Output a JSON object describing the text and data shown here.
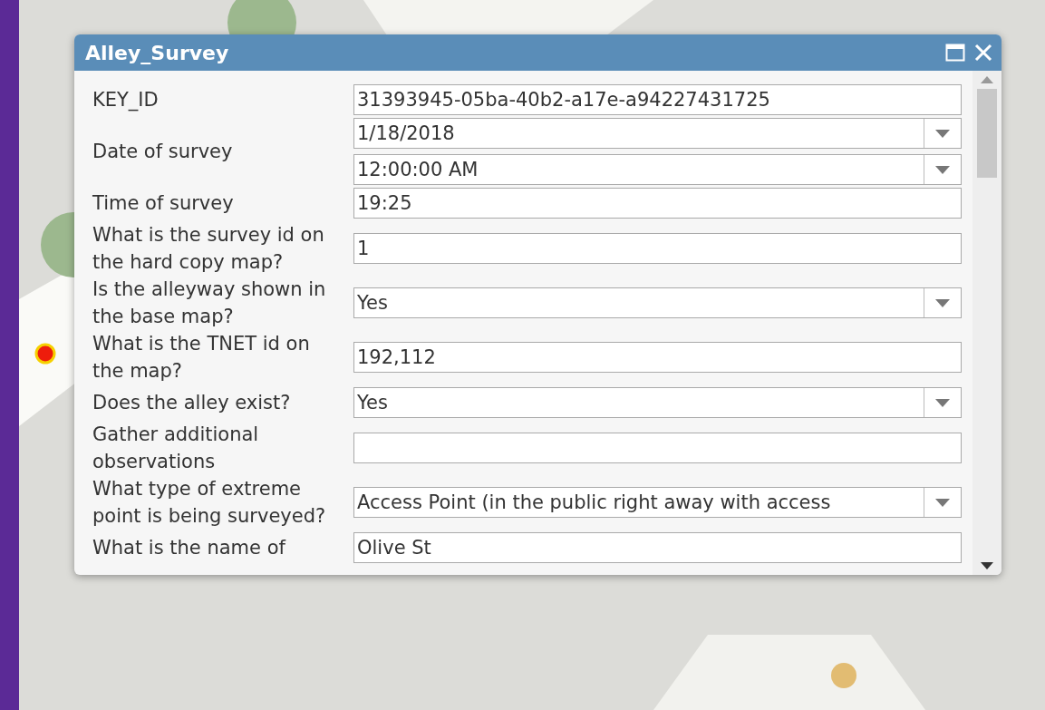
{
  "dialog": {
    "title": "Alley_Survey",
    "fields": [
      {
        "label": "KEY_ID",
        "kind": "text",
        "values": [
          "31393945-05ba-40b2-a17e-a94227431725"
        ]
      },
      {
        "label": "Date of survey",
        "kind": "datetime",
        "values": [
          "1/18/2018",
          "12:00:00 AM"
        ]
      },
      {
        "label": "Time of survey",
        "kind": "text",
        "values": [
          "19:25"
        ]
      },
      {
        "label": "What is the survey id on the hard copy map?",
        "kind": "text",
        "values": [
          "1"
        ]
      },
      {
        "label": "Is the alleyway shown in the base map?",
        "kind": "dropdown",
        "values": [
          "Yes"
        ]
      },
      {
        "label": "What is the TNET id on the map?",
        "kind": "text",
        "values": [
          "192,112"
        ]
      },
      {
        "label": "Does the alley exist?",
        "kind": "dropdown",
        "values": [
          "Yes"
        ]
      },
      {
        "label": "Gather additional observations",
        "kind": "text"
      },
      {
        "label": "What type of extreme point is being surveyed?",
        "kind": "dropdown",
        "values": [
          "Access Point (in the public right away with access"
        ]
      },
      {
        "label": "What is the name of",
        "kind": "text",
        "values": [
          "Olive St"
        ]
      }
    ]
  }
}
